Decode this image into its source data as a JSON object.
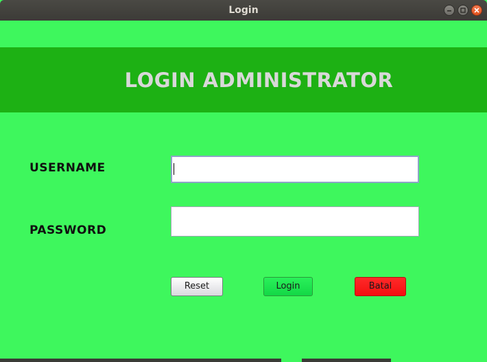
{
  "window": {
    "title": "Login"
  },
  "header": {
    "heading": "LOGIN ADMINISTRATOR"
  },
  "form": {
    "username_label": "USERNAME",
    "username_value": "",
    "password_label": "PASSWORD",
    "password_value": ""
  },
  "buttons": {
    "reset": "Reset",
    "login": "Login",
    "batal": "Batal"
  },
  "colors": {
    "background": "#3ef75d",
    "header_band": "#1db114",
    "login_button": "#13d846",
    "batal_button": "#f41010"
  },
  "icons": {
    "minimize": "minimize-icon",
    "maximize": "maximize-icon",
    "close": "close-icon"
  }
}
